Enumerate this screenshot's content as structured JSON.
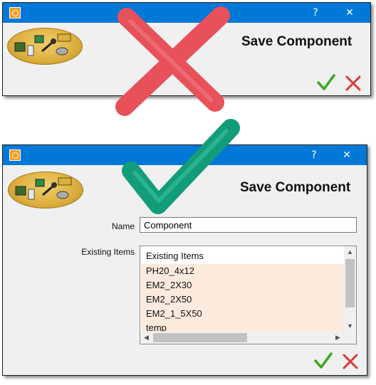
{
  "top_dialog": {
    "title": "Save Component",
    "titlebar_help": "?",
    "titlebar_close": "✕"
  },
  "bottom_dialog": {
    "title": "Save Component",
    "titlebar_help": "?",
    "titlebar_close": "✕",
    "name_label": "Name",
    "name_value": "Component",
    "existing_label": "Existing Items",
    "list": {
      "header": "Existing Items",
      "items": [
        "PH20_4x12",
        "EM2_2X30",
        "EM2_2X50",
        "EM2_1_5X50",
        "temp"
      ]
    }
  },
  "annotations": {
    "wrong_mark_color": "#e8505a",
    "right_mark_color": "#139c7a"
  },
  "colors": {
    "titlebar": "#0078d7",
    "list_selection_bg": "#fcebdd",
    "ok_green": "#3aa81e",
    "cancel_red": "#d63a3a"
  }
}
